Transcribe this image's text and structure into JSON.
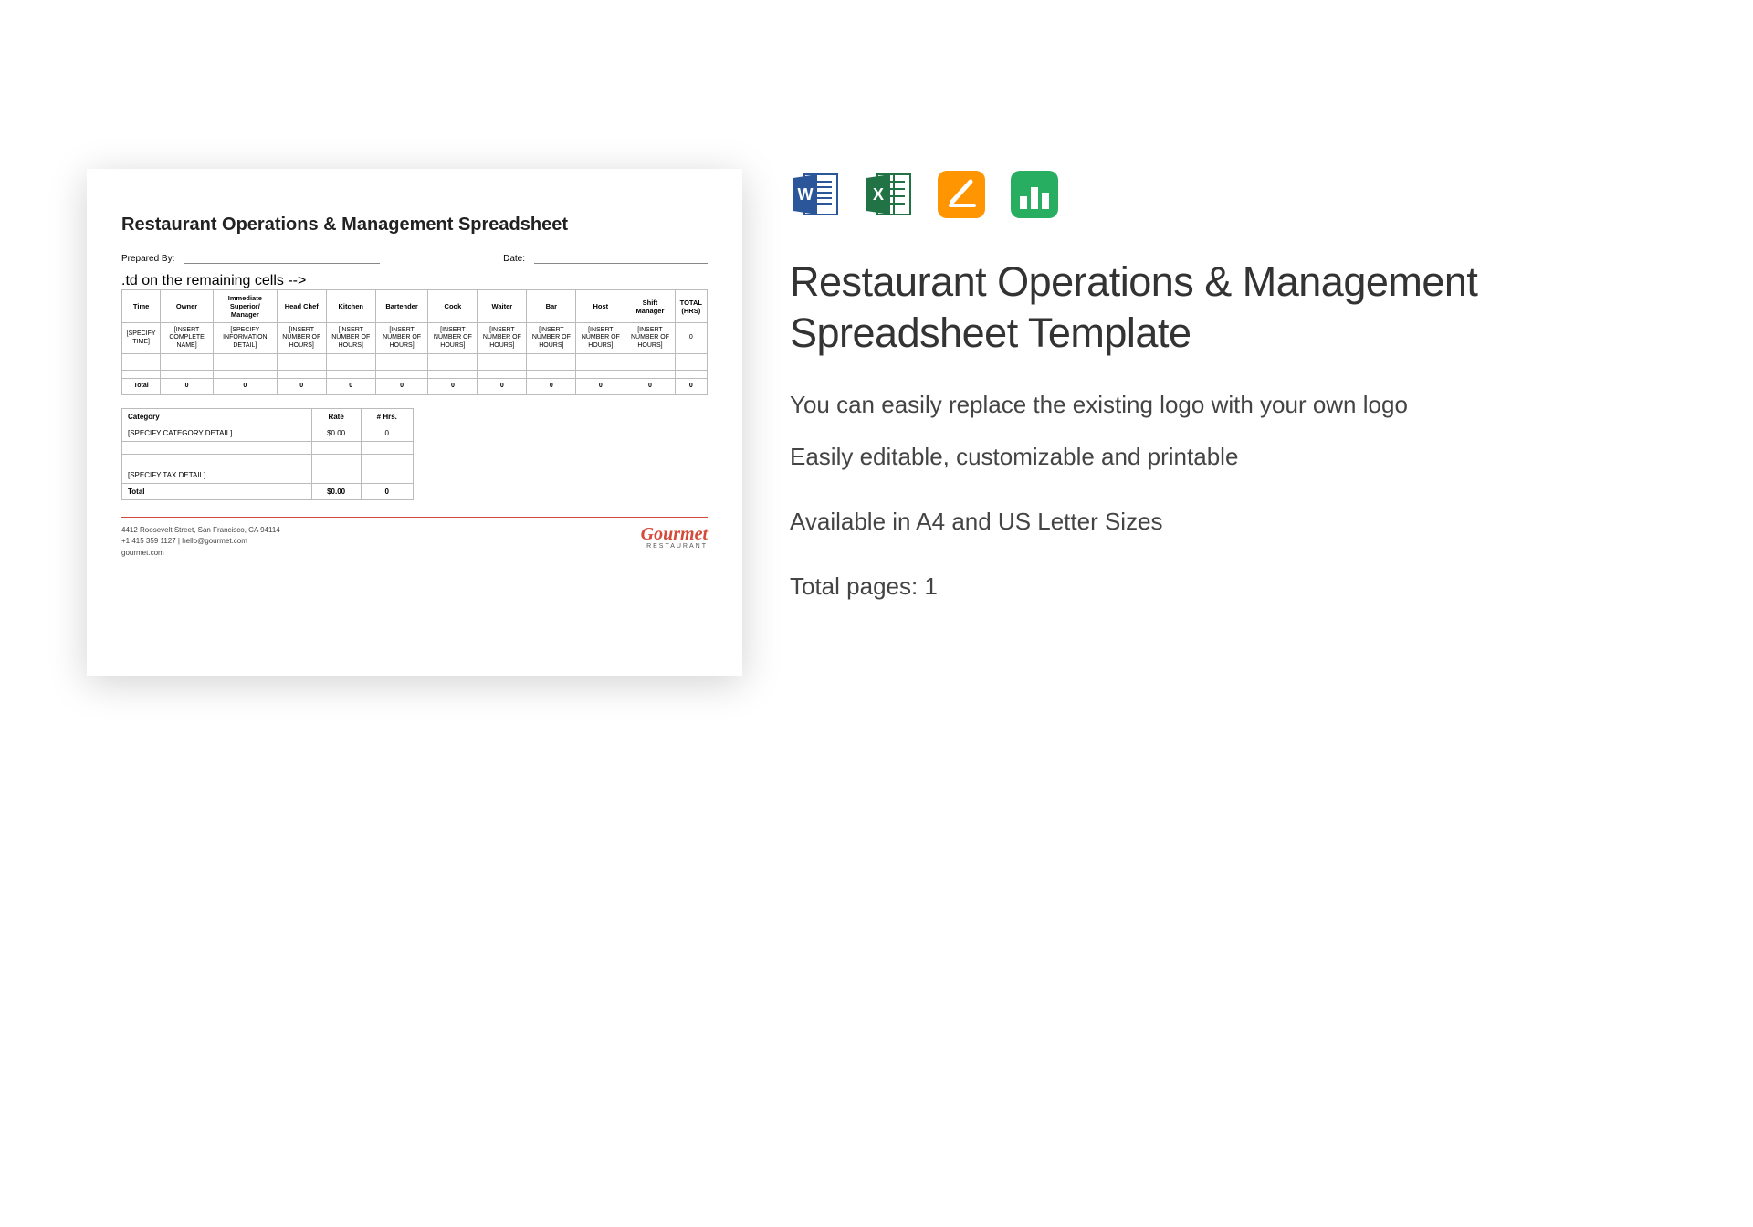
{
  "preview": {
    "title": "Restaurant Operations & Management Spreadsheet",
    "prepared_by_label": "Prepared By:",
    "date_label": "Date:",
    "table": {
      "headers": [
        "Time",
        "Owner",
        "Immediate Superior/ Manager",
        "Head Chef",
        "Kitchen",
        "Bartender",
        "Cook",
        "Waiter",
        "Bar",
        "Host",
        "Shift Manager",
        "TOTAL (HRS)"
      ],
      "row1": [
        "[SPECIFY TIME]",
        "[INSERT COMPLETE NAME]",
        "[SPECIFY INFORMATION DETAIL]",
        "[INSERT NUMBER OF HOURS]",
        "[INSERT NUMBER OF HOURS]",
        "[INSERT NUMBER OF HOURS]",
        "[INSERT NUMBER OF HOURS]",
        "[INSERT NUMBER OF HOURS]",
        "[INSERT NUMBER OF HOURS]",
        "[INSERT NUMBER OF HOURS]",
        "[INSERT NUMBER OF HOURS]",
        "0"
      ],
      "total_label": "Total",
      "totals": [
        "0",
        "0",
        "0",
        "0",
        "0",
        "0",
        "0",
        "0",
        "0",
        "0",
        "0"
      ]
    },
    "subtable": {
      "headers": [
        "Category",
        "Rate",
        "# Hrs."
      ],
      "row1": [
        "[SPECIFY CATEGORY DETAIL]",
        "$0.00",
        "0"
      ],
      "tax_row": "[SPECIFY TAX DETAIL]",
      "total_label": "Total",
      "total_rate": "$0.00",
      "total_hrs": "0"
    },
    "footer": {
      "address": "4412 Roosevelt Street, San Francisco, CA 94114",
      "contact": "+1 415 359 1127 | hello@gourmet.com",
      "website": "gourmet.com",
      "brand": "Gourmet",
      "brand_sub": "RESTAURANT"
    }
  },
  "side": {
    "title": "Restaurant Operations & Management Spreadsheet Template",
    "desc1": "You can easily replace the existing logo with your own logo",
    "desc2": "Easily editable, customizable and printable",
    "desc3": "Available in A4 and US Letter Sizes",
    "desc4": "Total pages: 1"
  }
}
